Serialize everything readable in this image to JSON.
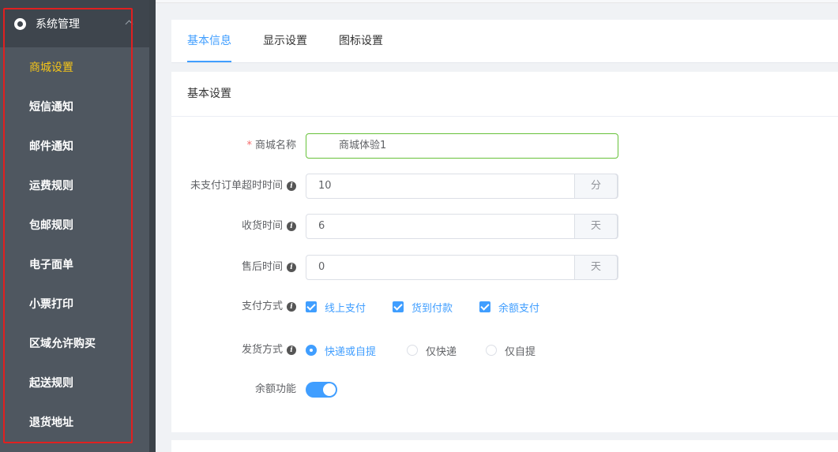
{
  "sidebar": {
    "group_label": "系统管理",
    "items": [
      {
        "label": "商城设置",
        "active": true
      },
      {
        "label": "短信通知"
      },
      {
        "label": "邮件通知"
      },
      {
        "label": "运费规则"
      },
      {
        "label": "包邮规则"
      },
      {
        "label": "电子面单"
      },
      {
        "label": "小票打印"
      },
      {
        "label": "区域允许购买"
      },
      {
        "label": "起送规则"
      },
      {
        "label": "退货地址"
      }
    ]
  },
  "tabs": [
    {
      "label": "基本信息",
      "active": true
    },
    {
      "label": "显示设置"
    },
    {
      "label": "图标设置"
    }
  ],
  "section_title": "基本设置",
  "form": {
    "shop_name": {
      "label": "商城名称",
      "value": "商城体验1",
      "required": true
    },
    "unpaid_timeout": {
      "label": "未支付订单超时时间",
      "value": "10",
      "unit": "分"
    },
    "receive_time": {
      "label": "收货时间",
      "value": "6",
      "unit": "天"
    },
    "aftersale_time": {
      "label": "售后时间",
      "value": "0",
      "unit": "天"
    },
    "payment": {
      "label": "支付方式",
      "options": [
        {
          "label": "线上支付",
          "checked": true
        },
        {
          "label": "货到付款",
          "checked": true
        },
        {
          "label": "余额支付",
          "checked": true
        }
      ]
    },
    "delivery": {
      "label": "发货方式",
      "options": [
        {
          "label": "快递或自提",
          "selected": true
        },
        {
          "label": "仅快递",
          "selected": false
        },
        {
          "label": "仅自提",
          "selected": false
        }
      ]
    },
    "balance": {
      "label": "余额功能",
      "enabled": true
    }
  },
  "colors": {
    "accent": "#409eff",
    "active_menu": "#f5c518",
    "sidebar_bg": "#4f5760",
    "valid_border": "#67c23a"
  }
}
